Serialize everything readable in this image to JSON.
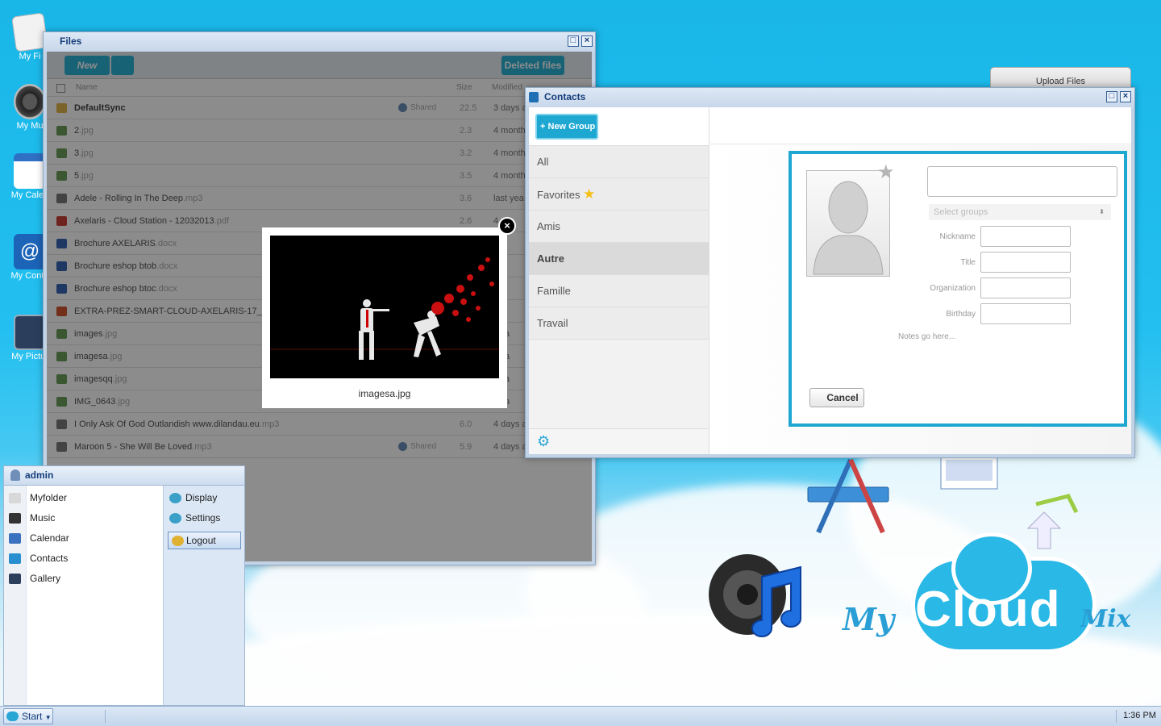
{
  "desktop": {
    "icons": [
      {
        "label": "My Fi",
        "icon": "document-icon"
      },
      {
        "label": "My Mu",
        "icon": "speaker-icon"
      },
      {
        "label": "My Calen",
        "icon": "calendar-icon"
      },
      {
        "label": "My Conta",
        "icon": "contacts-icon"
      },
      {
        "label": "My Pictur",
        "icon": "camera-icon"
      }
    ],
    "logo": "MyCloudMix",
    "upload_files": "Upload Files"
  },
  "files_window": {
    "title": "Files",
    "new_button": "New",
    "deleted_files_button": "Deleted files",
    "columns": {
      "name": "Name",
      "size": "Size",
      "modified": "Modified"
    },
    "rows": [
      {
        "name": "DefaultSync",
        "ext": "",
        "shared": "Shared",
        "size": "22.5",
        "modified": "3 days a",
        "icon": "folder-icon",
        "bold": true
      },
      {
        "name": "2",
        "ext": ".jpg",
        "shared": "",
        "size": "2.3",
        "modified": "4 month",
        "icon": "image-file-icon"
      },
      {
        "name": "3",
        "ext": ".jpg",
        "shared": "",
        "size": "3.2",
        "modified": "4 month",
        "icon": "image-file-icon"
      },
      {
        "name": "5",
        "ext": ".jpg",
        "shared": "",
        "size": "3.5",
        "modified": "4 month",
        "icon": "image-file-icon"
      },
      {
        "name": "Adele - Rolling In The Deep",
        "ext": ".mp3",
        "shared": "",
        "size": "3.6",
        "modified": "last yea",
        "icon": "music-file-icon"
      },
      {
        "name": "Axelaris - Cloud Station - 12032013",
        "ext": ".pdf",
        "shared": "",
        "size": "2.6",
        "modified": "4",
        "icon": "pdf-file-icon"
      },
      {
        "name": "Brochure AXELARIS",
        "ext": ".docx",
        "shared": "",
        "size": "",
        "modified": "",
        "icon": "doc-file-icon"
      },
      {
        "name": "Brochure eshop btob",
        "ext": ".docx",
        "shared": "",
        "size": "",
        "modified": "",
        "icon": "doc-file-icon"
      },
      {
        "name": "Brochure eshop btoc",
        "ext": ".docx",
        "shared": "",
        "size": "",
        "modified": "",
        "icon": "doc-file-icon"
      },
      {
        "name": "EXTRA-PREZ-SMART-CLOUD-AXELARIS-17_01_",
        "ext": "",
        "shared": "",
        "size": "",
        "modified": "",
        "icon": "ppt-file-icon"
      },
      {
        "name": "images",
        "ext": ".jpg",
        "shared": "",
        "size": "",
        "modified": "ys a",
        "icon": "image-file-icon"
      },
      {
        "name": "imagesa",
        "ext": ".jpg",
        "shared": "",
        "size": "",
        "modified": "ys a",
        "icon": "image-file-icon"
      },
      {
        "name": "imagesqq",
        "ext": ".jpg",
        "shared": "",
        "size": "",
        "modified": "ys a",
        "icon": "image-file-icon"
      },
      {
        "name": "IMG_0643",
        "ext": ".jpg",
        "shared": "",
        "size": "",
        "modified": "ys a",
        "icon": "image-file-icon"
      },
      {
        "name": "I Only Ask Of God Outlandish www.dilandau.eu",
        "ext": ".mp3",
        "shared": "",
        "size": "6.0",
        "modified": "4 days a",
        "icon": "music-file-icon"
      },
      {
        "name": "Maroon 5 - She Will Be Loved",
        "ext": ".mp3",
        "shared": "Shared",
        "size": "5.9",
        "modified": "4 days a",
        "icon": "music-file-icon"
      }
    ]
  },
  "lightbox": {
    "caption": "imagesa.jpg"
  },
  "contacts_window": {
    "title": "Contacts",
    "new_group_button": "New Group",
    "groups": [
      {
        "label": "All",
        "selected": false
      },
      {
        "label": "Favorites",
        "selected": false,
        "star": true
      },
      {
        "label": "Amis",
        "selected": false
      },
      {
        "label": "Autre",
        "selected": true
      },
      {
        "label": "Famille",
        "selected": false
      },
      {
        "label": "Travail",
        "selected": false
      }
    ],
    "form": {
      "select_groups_placeholder": "Select groups",
      "nickname_label": "Nickname",
      "title_label": "Title",
      "organization_label": "Organization",
      "birthday_label": "Birthday",
      "notes_placeholder": "Notes go here...",
      "cancel_button": "Cancel"
    }
  },
  "start_menu": {
    "user": "admin",
    "apps": [
      {
        "label": "Myfolder",
        "icon": "folder-icon"
      },
      {
        "label": "Music",
        "icon": "speaker-icon"
      },
      {
        "label": "Calendar",
        "icon": "calendar-icon"
      },
      {
        "label": "Contacts",
        "icon": "contacts-icon"
      },
      {
        "label": "Gallery",
        "icon": "gallery-icon"
      }
    ],
    "system": [
      {
        "label": "Display",
        "icon": "display-gear-icon"
      },
      {
        "label": "Settings",
        "icon": "settings-gear-icon"
      },
      {
        "label": "Logout",
        "icon": "key-icon"
      }
    ]
  },
  "taskbar": {
    "start_label": "Start",
    "clock": "1:36 PM"
  },
  "colors": {
    "accent": "#1ea7d1",
    "title_text": "#153d7a",
    "desktop_bg": "#19b6e8"
  }
}
